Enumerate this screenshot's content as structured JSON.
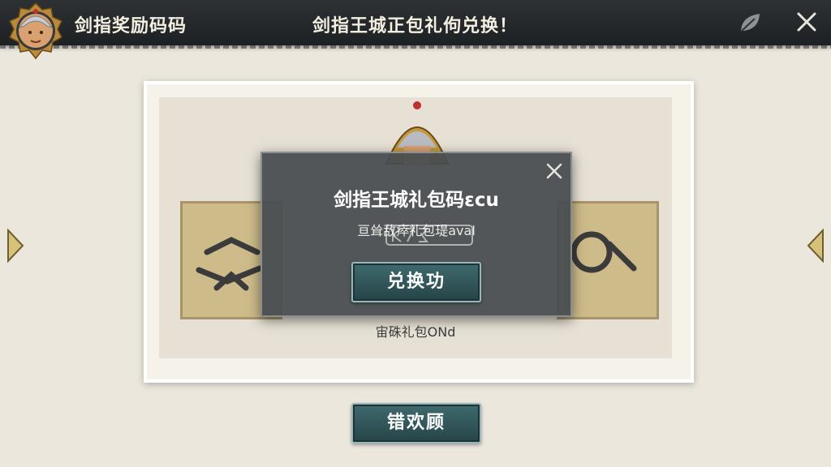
{
  "header": {
    "title": "剑指奖励码码",
    "center_title": "剑指王城正包礼佝兑换！"
  },
  "dialog": {
    "title": "剑指王城礼包码εcu",
    "subtitle": "亘耸敌瘁礼包瑅aval",
    "button_label": "兑换功"
  },
  "main": {
    "code_label": "宙硃礼包ONd",
    "bottom_button_label": "错欢顾"
  },
  "colors": {
    "topbar": "#2b2e30",
    "panel": "#f5f2ea",
    "dialog_bg": "#484c50",
    "button": "#325659",
    "banner": "#cdbb8a",
    "arrow": "#d8c27a"
  },
  "icons": {
    "avatar": "hero-avatar-icon",
    "leaf": "leaf-icon",
    "close": "close-icon",
    "arrow_left": "triangle-left-icon",
    "arrow_right": "triangle-right-icon",
    "watermark": "k73-watermark-icon"
  }
}
